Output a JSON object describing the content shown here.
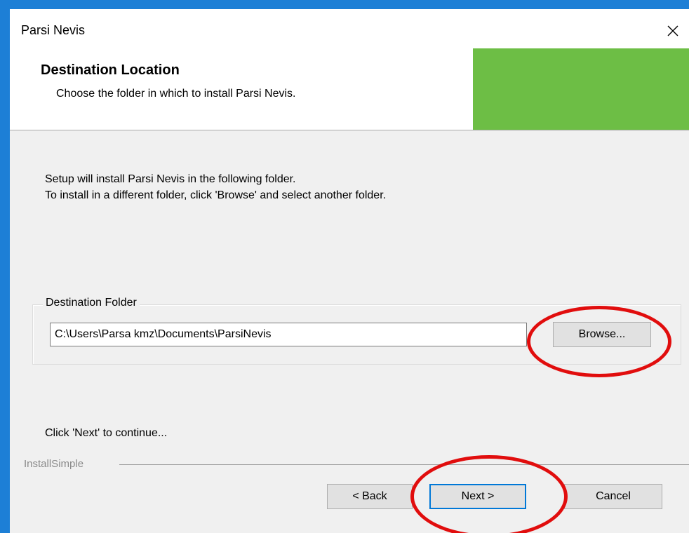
{
  "window": {
    "title": "Parsi Nevis",
    "close_glyph": "✕"
  },
  "header": {
    "title": "Destination Location",
    "subtitle": "Choose the folder in which to install Parsi Nevis.",
    "logo_color": "#6dbe45"
  },
  "body": {
    "line1": "Setup will install Parsi Nevis in the following folder.",
    "line2": "To install in a different folder, click 'Browse' and select another folder."
  },
  "destination": {
    "group_label": "Destination Folder",
    "path": "C:\\Users\\Parsa kmz\\Documents\\ParsiNevis",
    "browse_label": "Browse..."
  },
  "footer": {
    "continue_text": "Click 'Next' to continue...",
    "brand": "InstallSimple",
    "back_label": "< Back",
    "next_label": "Next >",
    "cancel_label": "Cancel"
  },
  "colors": {
    "accent": "#0078d7",
    "highlight": "#e10d0d",
    "titlebar_border": "#1d7fd6"
  },
  "icons": {
    "close": "close-icon"
  }
}
